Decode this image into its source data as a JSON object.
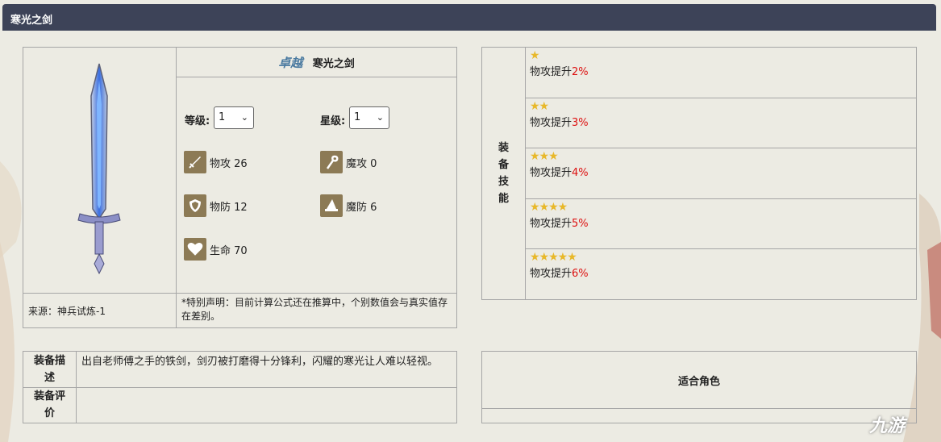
{
  "header": {
    "title": "寒光之剑"
  },
  "item": {
    "rank": "卓越",
    "name": "寒光之剑",
    "level_label": "等级:",
    "level_value": "1",
    "star_label": "星级:",
    "star_value": "1",
    "stats": {
      "patk": "物攻 26",
      "matk": "魔攻 0",
      "pdef": "物防 12",
      "mdef": "魔防 6",
      "hp": "生命 70"
    },
    "source": "来源：神兵试炼-1",
    "note": "*特别声明：目前计算公式还在推算中，个别数值会与真实值存在差别。"
  },
  "skills": {
    "header": "装备技能",
    "items": [
      {
        "stars": "★",
        "text": "物攻提升",
        "pct": "2%"
      },
      {
        "stars": "★★",
        "text": "物攻提升",
        "pct": "3%"
      },
      {
        "stars": "★★★",
        "text": "物攻提升",
        "pct": "4%"
      },
      {
        "stars": "★★★★",
        "text": "物攻提升",
        "pct": "5%"
      },
      {
        "stars": "★★★★★",
        "text": "物攻提升",
        "pct": "6%"
      }
    ]
  },
  "desc": {
    "desc_label": "装备描述",
    "desc_value": "出自老师傅之手的铁剑，剑刃被打磨得十分锋利，闪耀的寒光让人难以轻视。",
    "eval_label": "装备评价",
    "eval_value": ""
  },
  "roles": {
    "title": "适合角色"
  },
  "watermark": "九游",
  "colors": {
    "titlebar": "#3d4358",
    "accent_red": "#dd1111",
    "icon_bg": "#8c7a55"
  }
}
